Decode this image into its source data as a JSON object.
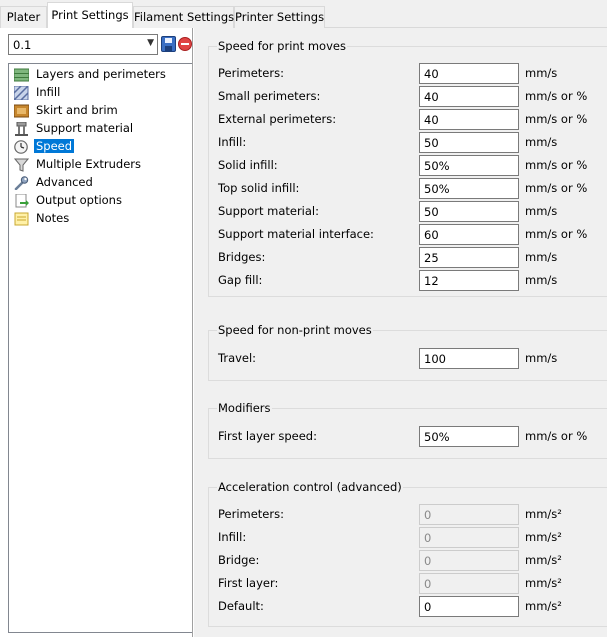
{
  "tabs": [
    {
      "label": "Plater"
    },
    {
      "label": "Print Settings"
    },
    {
      "label": "Filament Settings"
    },
    {
      "label": "Printer Settings"
    }
  ],
  "preset": {
    "value": "0.1"
  },
  "tree": [
    {
      "label": "Layers and perimeters",
      "icon": "layers-icon"
    },
    {
      "label": "Infill",
      "icon": "infill-icon"
    },
    {
      "label": "Skirt and brim",
      "icon": "skirt-brim-icon"
    },
    {
      "label": "Support material",
      "icon": "support-material-icon"
    },
    {
      "label": "Speed",
      "icon": "speed-clock-icon"
    },
    {
      "label": "Multiple Extruders",
      "icon": "funnel-icon"
    },
    {
      "label": "Advanced",
      "icon": "wrench-icon"
    },
    {
      "label": "Output options",
      "icon": "output-page-icon"
    },
    {
      "label": "Notes",
      "icon": "note-icon"
    }
  ],
  "groups": {
    "print_moves": {
      "title": "Speed for print moves",
      "rows": [
        {
          "label": "Perimeters:",
          "value": "40",
          "unit": "mm/s"
        },
        {
          "label": "Small perimeters:",
          "value": "40",
          "unit": "mm/s or %"
        },
        {
          "label": "External perimeters:",
          "value": "40",
          "unit": "mm/s or %"
        },
        {
          "label": "Infill:",
          "value": "50",
          "unit": "mm/s"
        },
        {
          "label": "Solid infill:",
          "value": "50%",
          "unit": "mm/s or %"
        },
        {
          "label": "Top solid infill:",
          "value": "50%",
          "unit": "mm/s or %"
        },
        {
          "label": "Support material:",
          "value": "50",
          "unit": "mm/s"
        },
        {
          "label": "Support material interface:",
          "value": "60",
          "unit": "mm/s or %"
        },
        {
          "label": "Bridges:",
          "value": "25",
          "unit": "mm/s"
        },
        {
          "label": "Gap fill:",
          "value": "12",
          "unit": "mm/s"
        }
      ]
    },
    "non_print_moves": {
      "title": "Speed for non-print moves",
      "rows": [
        {
          "label": "Travel:",
          "value": "100",
          "unit": "mm/s"
        }
      ]
    },
    "modifiers": {
      "title": "Modifiers",
      "rows": [
        {
          "label": "First layer speed:",
          "value": "50%",
          "unit": "mm/s or %"
        }
      ]
    },
    "acceleration": {
      "title": "Acceleration control (advanced)",
      "rows": [
        {
          "label": "Perimeters:",
          "value": "0",
          "unit": "mm/s²"
        },
        {
          "label": "Infill:",
          "value": "0",
          "unit": "mm/s²"
        },
        {
          "label": "Bridge:",
          "value": "0",
          "unit": "mm/s²"
        },
        {
          "label": "First layer:",
          "value": "0",
          "unit": "mm/s²"
        },
        {
          "label": "Default:",
          "value": "0",
          "unit": "mm/s²"
        }
      ]
    }
  }
}
